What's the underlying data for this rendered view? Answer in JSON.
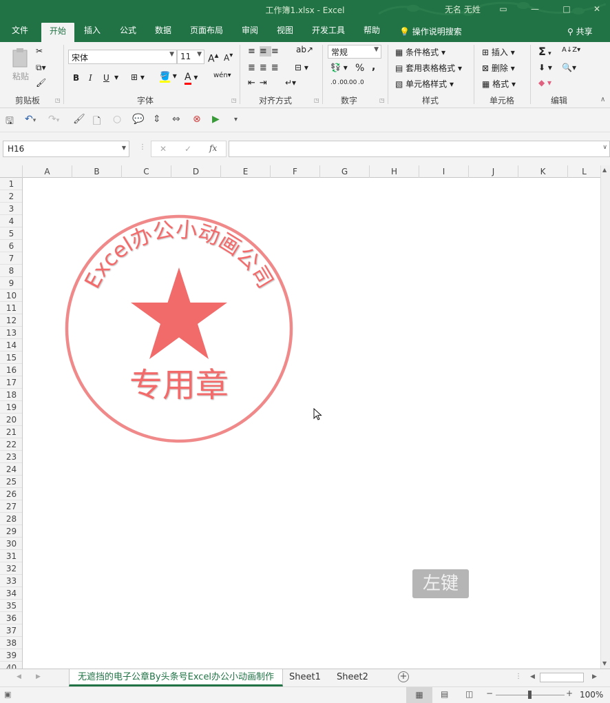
{
  "window": {
    "title": "工作簿1.xlsx  -  Excel",
    "user": "无名 无姓",
    "controls": {
      "minimize": "—",
      "restore": "□",
      "close": "✕"
    }
  },
  "menu": {
    "tabs": [
      "文件",
      "开始",
      "插入",
      "公式",
      "数据",
      "页面布局",
      "审阅",
      "视图",
      "开发工具",
      "帮助"
    ],
    "active_tab": "开始",
    "tell_me": "操作说明搜索",
    "share": "共享"
  },
  "ribbon": {
    "clipboard": {
      "label": "剪贴板",
      "paste": "粘贴"
    },
    "font": {
      "label": "字体",
      "name": "宋体",
      "size": "11",
      "bold": "B",
      "italic": "I",
      "underline": "U",
      "grow": "A",
      "shrink": "A",
      "font_color": "A",
      "wen": "wén"
    },
    "alignment": {
      "label": "对齐方式"
    },
    "number": {
      "label": "数字",
      "format": "常规",
      "percent": "%",
      "comma": ",",
      "inc_dec": ".0 .00",
      "dec_dec": ".00 .0"
    },
    "styles": {
      "label": "样式",
      "cond": "条件格式",
      "table": "套用表格格式",
      "cell": "单元格样式"
    },
    "cells": {
      "label": "单元格",
      "insert": "插入",
      "delete": "删除",
      "format": "格式"
    },
    "editing": {
      "label": "编辑",
      "sum": "Σ",
      "sort": "A↓Z"
    }
  },
  "formula_bar": {
    "name_box": "H16",
    "cancel": "✕",
    "enter": "✓",
    "fx": "fx",
    "formula": ""
  },
  "grid": {
    "columns": [
      "A",
      "B",
      "C",
      "D",
      "E",
      "F",
      "G",
      "H",
      "I",
      "J",
      "K",
      "L"
    ],
    "rows": [
      "1",
      "2",
      "3",
      "4",
      "5",
      "6",
      "7",
      "8",
      "9",
      "10",
      "11",
      "12",
      "13",
      "14",
      "15",
      "16",
      "17",
      "18",
      "19",
      "20",
      "21",
      "22",
      "23",
      "24",
      "25",
      "26",
      "27",
      "28",
      "29",
      "30",
      "31",
      "32",
      "33",
      "34",
      "35",
      "36",
      "37",
      "38",
      "39",
      "40"
    ]
  },
  "stamp": {
    "arc_text": "Excel办公小动画公司",
    "center_text": "专用章",
    "color": "#f26b6b"
  },
  "sheet_tabs": {
    "tabs": [
      "无遮挡的电子公章By头条号Excel办公小动画制作",
      "Sheet1",
      "Sheet2"
    ],
    "active": 0,
    "add": "+"
  },
  "status": {
    "zoom": "100%",
    "minus": "−",
    "plus": "+"
  },
  "overlay": {
    "mouse_hint": "左键"
  }
}
